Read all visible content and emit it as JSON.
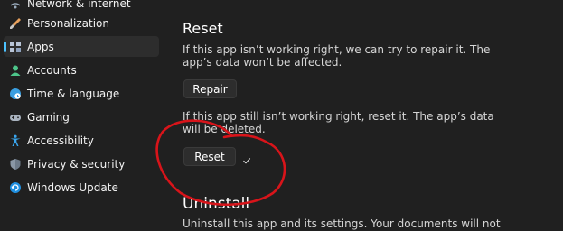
{
  "sidebar": {
    "items": [
      {
        "label": "Network & internet",
        "icon": "network-icon"
      },
      {
        "label": "Personalization",
        "icon": "paintbrush-icon"
      },
      {
        "label": "Apps",
        "icon": "apps-icon",
        "selected": true
      },
      {
        "label": "Accounts",
        "icon": "person-icon"
      },
      {
        "label": "Time & language",
        "icon": "globe-clock-icon"
      },
      {
        "label": "Gaming",
        "icon": "gamepad-icon"
      },
      {
        "label": "Accessibility",
        "icon": "accessibility-icon"
      },
      {
        "label": "Privacy & security",
        "icon": "shield-icon"
      },
      {
        "label": "Windows Update",
        "icon": "update-icon"
      }
    ]
  },
  "reset_section": {
    "title": "Reset",
    "repair_desc_line1": "If this app isn’t working right, we can try to repair it. The",
    "repair_desc_line2": "app’s data won’t be affected.",
    "repair_label": "Repair",
    "reset_desc_line1": "If this app still isn’t working right, reset it. The app’s data",
    "reset_desc_line2": "will be deleted.",
    "reset_label": "Reset"
  },
  "uninstall_section": {
    "title": "Uninstall",
    "desc_line1": "Uninstall this app and its settings. Your documents will not"
  },
  "colors": {
    "background": "#202020",
    "accent": "#4cc2ff",
    "annotation": "#d8141a"
  }
}
